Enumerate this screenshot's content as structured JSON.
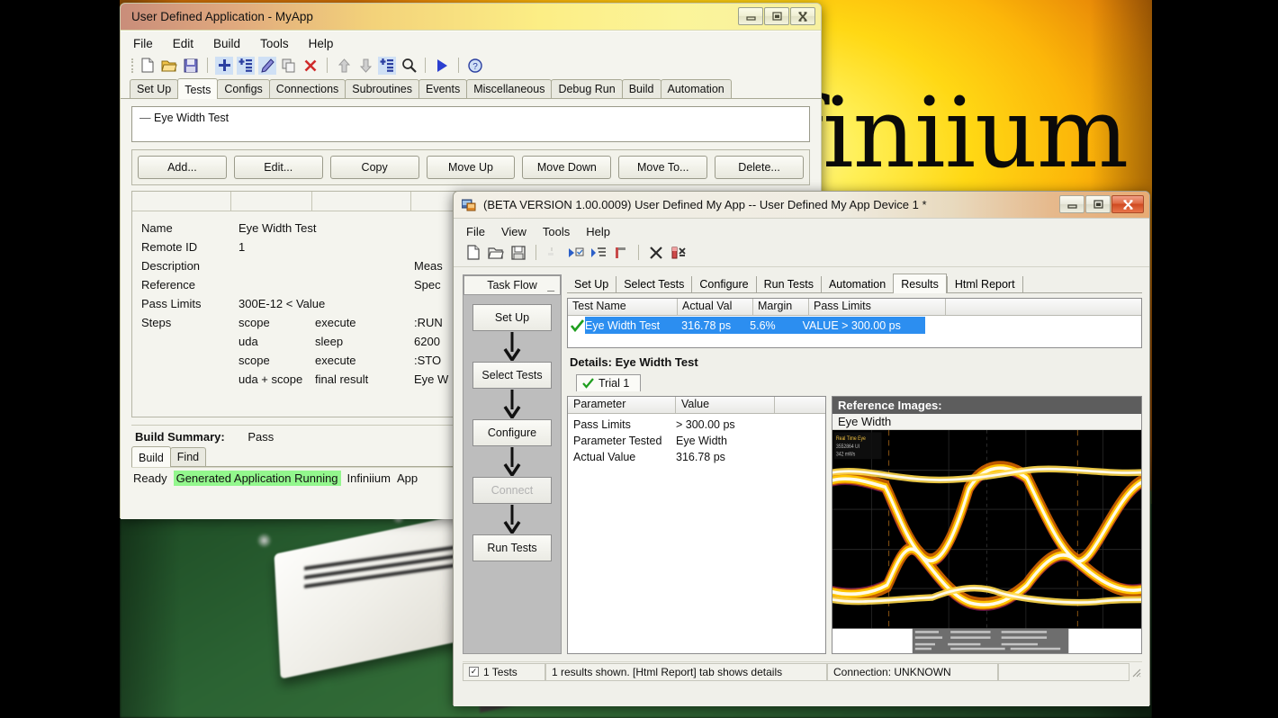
{
  "desktop": {
    "brand_word": "infiniium"
  },
  "window1": {
    "title": "User Defined Application - MyApp",
    "buttons": {
      "minimize": "─",
      "maximize": "❐",
      "close": "✕"
    },
    "menu": [
      "File",
      "Edit",
      "Build",
      "Tools",
      "Help"
    ],
    "toolbar_icons": [
      "new-file-icon",
      "open-folder-icon",
      "save-icon",
      "sep",
      "add-plus-icon",
      "add-item-icon",
      "edit-pencil-icon",
      "copy-icon",
      "delete-x-icon",
      "sep",
      "move-up-icon",
      "move-down-icon",
      "move-to-icon",
      "search-icon",
      "sep",
      "run-play-icon",
      "sep",
      "help-icon"
    ],
    "tabs": [
      "Set Up",
      "Tests",
      "Configs",
      "Connections",
      "Subroutines",
      "Events",
      "Miscellaneous",
      "Debug Run",
      "Build",
      "Automation"
    ],
    "selected_tab": "Tests",
    "tree_item": "Eye Width Test",
    "action_buttons": [
      "Add...",
      "Edit...",
      "Copy",
      "Move Up",
      "Move Down",
      "Move To...",
      "Delete..."
    ],
    "details": [
      {
        "label": "Name",
        "c2": "Eye Width Test",
        "c3": "",
        "c4": ""
      },
      {
        "label": "Remote ID",
        "c2": "1",
        "c3": "",
        "c4": ""
      },
      {
        "label": "Description",
        "c2": "",
        "c3": "Meas",
        "c4": ""
      },
      {
        "label": "Reference",
        "c2": "",
        "c3": "Spec",
        "c4": ""
      },
      {
        "label": "Pass Limits",
        "c2": "300E-12 < Value",
        "c3": "",
        "c4": ""
      },
      {
        "label": "Steps",
        "c2": "scope",
        "c3": "execute",
        "c4": ":RUN"
      },
      {
        "label": "",
        "c2": "uda",
        "c3": "sleep",
        "c4": "6200"
      },
      {
        "label": "",
        "c2": "scope",
        "c3": "execute",
        "c4": ":STO"
      },
      {
        "label": "",
        "c2": "uda + scope",
        "c3": "final result",
        "c4": "Eye W"
      }
    ],
    "build_summary_label": "Build Summary:",
    "build_summary_value": "Pass",
    "bottom_tabs": [
      "Build",
      "Find"
    ],
    "bottom_selected_tab": "Build",
    "status": {
      "ready": "Ready",
      "highlight": "Generated Application Running",
      "rest": "Infiniium",
      "rest2": "App"
    }
  },
  "window2": {
    "title": "(BETA VERSION 1.00.0009) User Defined My App -- User Defined My App Device 1 *",
    "buttons": {
      "minimize": "─",
      "maximize": "❐",
      "close": "✕"
    },
    "menu": [
      "File",
      "View",
      "Tools",
      "Help"
    ],
    "toolbar_icons": [
      "new-file-icon",
      "open-folder-icon",
      "save-icon",
      "sep",
      "run-disabled-icon",
      "run-selected-icon",
      "run-all-icon",
      "run-step-icon",
      "sep",
      "stop-x-icon",
      "clear-results-icon"
    ],
    "task_flow": {
      "header": "Task Flow",
      "collapse": "_",
      "steps": [
        {
          "label": "Set Up",
          "enabled": true
        },
        {
          "label": "Select Tests",
          "enabled": true
        },
        {
          "label": "Configure",
          "enabled": true
        },
        {
          "label": "Connect",
          "enabled": false
        },
        {
          "label": "Run Tests",
          "enabled": true
        }
      ]
    },
    "tabs": [
      "Set Up",
      "Select Tests",
      "Configure",
      "Run Tests",
      "Automation",
      "Results",
      "Html Report"
    ],
    "selected_tab": "Results",
    "results_table": {
      "headers": [
        "Test Name",
        "Actual Val",
        "Margin",
        "Pass Limits"
      ],
      "rows": [
        {
          "status": "pass",
          "name": "Eye Width Test",
          "actual": "316.78 ps",
          "margin": "5.6%",
          "limits": "VALUE > 300.00 ps"
        }
      ]
    },
    "details_title": "Details: Eye Width Test",
    "trial_tab": "Trial 1",
    "param_table": {
      "headers": [
        "Parameter",
        "Value"
      ],
      "rows": [
        {
          "param": "Pass Limits",
          "value": "> 300.00 ps"
        },
        {
          "param": "Parameter Tested",
          "value": "Eye Width"
        },
        {
          "param": "Actual Value",
          "value": "316.78 ps"
        }
      ]
    },
    "reference": {
      "header": "Reference Images:",
      "subtitle": "Eye Width",
      "scope_badge": [
        "Real Time Eye",
        "3552864 UI",
        "342 mWs"
      ]
    },
    "status_bar": {
      "tests_count": "1 Tests",
      "results_msg": "1 results shown. [Html Report] tab shows details",
      "connection": "Connection: UNKNOWN",
      "extra": ""
    }
  },
  "colors": {
    "selection_blue": "#2c8ef0",
    "pass_green": "#2e9b2e",
    "status_highlight": "#93f78d",
    "brand_yellow": "#ffd814",
    "scope_yellow": "#f5c518"
  }
}
